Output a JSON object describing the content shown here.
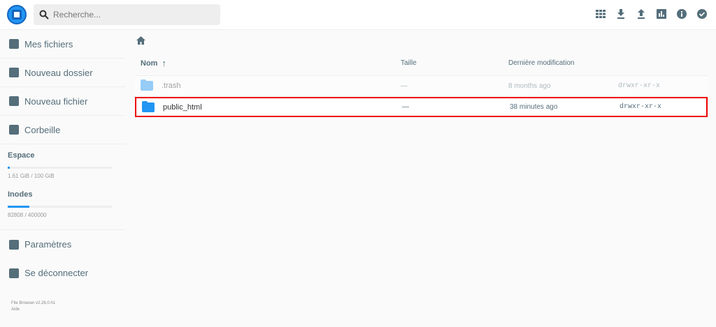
{
  "header": {
    "search_placeholder": "Recherche...",
    "actions": [
      "grid-view-icon",
      "download-icon",
      "upload-icon",
      "info-chart-icon",
      "info-icon",
      "select-icon"
    ]
  },
  "sidebar": {
    "items": [
      {
        "label": "Mes fichiers"
      },
      {
        "label": "Nouveau dossier"
      },
      {
        "label": "Nouveau fichier"
      },
      {
        "label": "Corbeille"
      }
    ],
    "space": {
      "title": "Espace",
      "value": "1.61 GiB / 100 GiB",
      "percent": 1.61
    },
    "inodes": {
      "title": "Inodes",
      "value": "82808 / 400000",
      "percent": 20.7
    },
    "bottom": [
      {
        "label": "Paramètres"
      },
      {
        "label": "Se déconnecter"
      }
    ],
    "version": "File Browser v2.26.0-h1",
    "help": "Aide"
  },
  "table": {
    "headers": {
      "name": "Nom",
      "size": "Taille",
      "modified": "Dernière modification"
    },
    "rows": [
      {
        "name": ".trash",
        "size": "—",
        "modified": "8 months ago",
        "perm": "drwxr-xr-x"
      },
      {
        "name": "public_html",
        "size": "—",
        "modified": "38 minutes ago",
        "perm": "drwxr-xr-x"
      }
    ]
  }
}
